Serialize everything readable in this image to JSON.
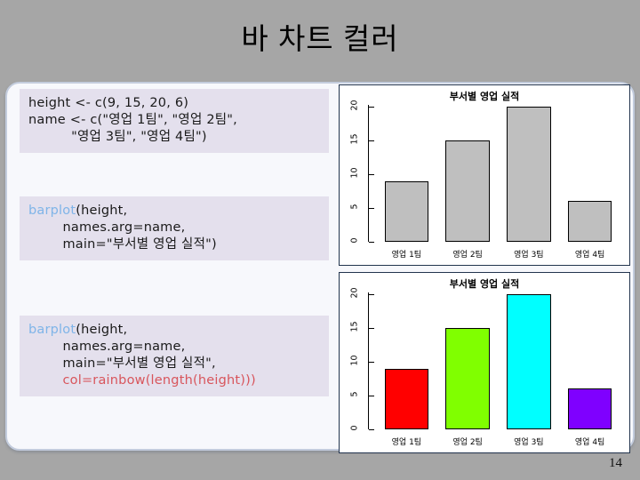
{
  "slide": {
    "title": "바 차트 컬러",
    "page_number": "14"
  },
  "code_blocks": [
    {
      "id": "block-1",
      "lines": [
        {
          "segments": [
            {
              "text": "height <- c(9, 15, 20, 6)",
              "style": "plain"
            }
          ]
        },
        {
          "segments": [
            {
              "text": "name <- c(\"영업 1팀\", \"영업 2팀\",",
              "style": "plain"
            }
          ]
        },
        {
          "segments": [
            {
              "text": "          \"영업 3팀\", \"영업 4팀\")",
              "style": "plain"
            }
          ]
        }
      ]
    },
    {
      "id": "block-2",
      "lines": [
        {
          "segments": [
            {
              "text": "barplot",
              "style": "fn"
            },
            {
              "text": "(height,",
              "style": "plain"
            }
          ]
        },
        {
          "segments": [
            {
              "text": "        names.arg=name,",
              "style": "plain"
            }
          ]
        },
        {
          "segments": [
            {
              "text": "        main=\"부서별 영업 실적\")",
              "style": "plain"
            }
          ]
        }
      ]
    },
    {
      "id": "block-3",
      "lines": [
        {
          "segments": [
            {
              "text": "barplot",
              "style": "fn"
            },
            {
              "text": "(height,",
              "style": "plain"
            }
          ]
        },
        {
          "segments": [
            {
              "text": "        names.arg=name,",
              "style": "plain"
            }
          ]
        },
        {
          "segments": [
            {
              "text": "        main=\"부서별 영업 실적\",",
              "style": "plain"
            }
          ]
        },
        {
          "segments": [
            {
              "text": "        col=rainbow(length(height)))",
              "style": "red"
            }
          ]
        }
      ]
    }
  ],
  "chart_data": [
    {
      "id": "plot-gray",
      "type": "bar",
      "title": "부서별 영업 실적",
      "categories": [
        "영업 1팀",
        "영업 2팀",
        "영업 3팀",
        "영업 4팀"
      ],
      "values": [
        9,
        15,
        20,
        6
      ],
      "colors": [
        "#bfbfbf",
        "#bfbfbf",
        "#bfbfbf",
        "#bfbfbf"
      ],
      "xlabel": "",
      "ylabel": "",
      "ylim": [
        0,
        20
      ],
      "yticks": [
        0,
        5,
        10,
        15,
        20
      ],
      "grid": false,
      "legend": false
    },
    {
      "id": "plot-rainbow",
      "type": "bar",
      "title": "부서별 영업 실적",
      "categories": [
        "영업 1팀",
        "영업 2팀",
        "영업 3팀",
        "영업 4팀"
      ],
      "values": [
        9,
        15,
        20,
        6
      ],
      "colors": [
        "#ff0000",
        "#80ff00",
        "#00ffff",
        "#7f00ff"
      ],
      "xlabel": "",
      "ylabel": "",
      "ylim": [
        0,
        20
      ],
      "yticks": [
        0,
        5,
        10,
        15,
        20
      ],
      "grid": false,
      "legend": false
    }
  ]
}
